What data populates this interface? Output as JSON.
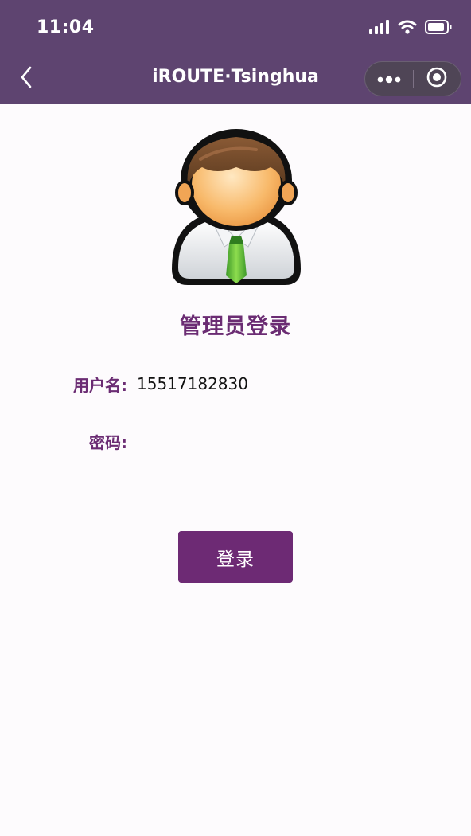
{
  "status_bar": {
    "time": "11:04",
    "icons": [
      "cellular-signal-icon",
      "wifi-icon",
      "battery-icon"
    ]
  },
  "nav": {
    "title": "iROUTE·Tsinghua",
    "back_icon": "chevron-left-icon",
    "capsule_icons": [
      "more-dots-icon",
      "close-target-icon"
    ]
  },
  "login": {
    "title": "管理员登录",
    "username_label": "用户名:",
    "username_value": "15517182830",
    "password_label": "密码:",
    "password_value": "",
    "button_label": "登录"
  },
  "colors": {
    "header_bg": "#5e4470",
    "accent": "#6b2c73",
    "button_bg": "#6d2a74",
    "page_bg": "#fdfbfd"
  }
}
